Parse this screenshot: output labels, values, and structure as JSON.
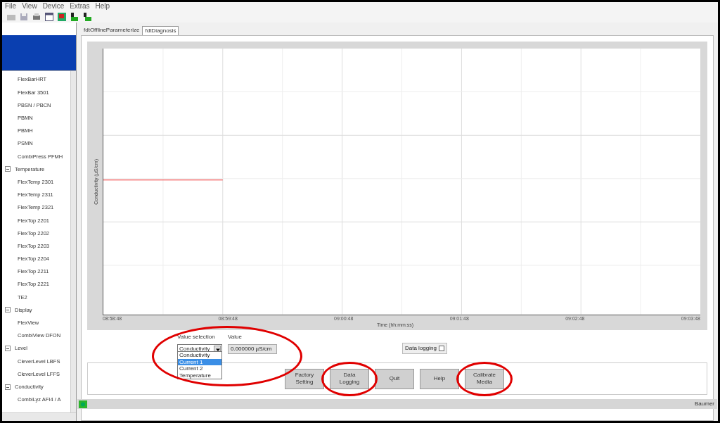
{
  "menu": [
    "File",
    "View",
    "Device",
    "Extras",
    "Help"
  ],
  "toolbar": [
    {
      "kind": "open"
    },
    {
      "kind": "save"
    },
    {
      "kind": "print"
    },
    {
      "kind": "window"
    },
    {
      "kind": "device"
    },
    {
      "kind": "connect"
    },
    {
      "kind": "disconnect"
    }
  ],
  "tree": [
    {
      "children": [
        {
          "label": "FlexBarHRT"
        },
        {
          "label": "FlexBar 3501"
        },
        {
          "label": "PBSN / PBCN"
        },
        {
          "label": "PBMN"
        },
        {
          "label": "PBMH"
        },
        {
          "label": "PSMN"
        },
        {
          "label": "CombiPress PFMH"
        }
      ]
    },
    {
      "label": "Temperature",
      "expanded": true,
      "children": [
        {
          "label": "FlexTemp 2301"
        },
        {
          "label": "FlexTemp 2311"
        },
        {
          "label": "FlexTemp 2321"
        },
        {
          "label": "FlexTop 2201"
        },
        {
          "label": "FlexTop 2202"
        },
        {
          "label": "FlexTop 2203"
        },
        {
          "label": "FlexTop 2204"
        },
        {
          "label": "FlexTop 2211"
        },
        {
          "label": "FlexTop 2221"
        },
        {
          "label": "TE2"
        }
      ]
    },
    {
      "label": "Display",
      "expanded": true,
      "children": [
        {
          "label": "FlexView"
        },
        {
          "label": "CombiView DFON"
        }
      ]
    },
    {
      "label": "Level",
      "expanded": true,
      "children": [
        {
          "label": "CleverLevel LBFS"
        },
        {
          "label": "CleverLevel LFFS"
        }
      ]
    },
    {
      "label": "Conductivity",
      "expanded": true,
      "children": [
        {
          "label": "CombiLyz AFI4 / A"
        }
      ]
    }
  ],
  "tabs": [
    {
      "label": "fdtOfflineParameterize",
      "selected": false
    },
    {
      "label": "fdtDiagnosis",
      "selected": true
    }
  ],
  "chart": {
    "ylabel": "Conductivity (µS/cm)",
    "xlabel": "Time (hh:mm:ss)",
    "xticks": [
      "08:58:48",
      "08:59:48",
      "09:00:48",
      "09:01:48",
      "09:02:48",
      "09:03:48"
    ]
  },
  "value_selection": {
    "label": "Value selection",
    "value": "Conductivity",
    "options": [
      {
        "label": "Conductivity",
        "highlighted": false
      },
      {
        "label": "Current 1",
        "highlighted": true
      },
      {
        "label": "Current 2",
        "highlighted": false
      },
      {
        "label": "Temperature",
        "highlighted": false
      }
    ]
  },
  "value": {
    "label": "Value",
    "value": "0.000000 µS/cm"
  },
  "data_logging": {
    "label": "Data logging",
    "checked": false
  },
  "buttons": [
    {
      "label": "Factory\nSetting",
      "circled": false
    },
    {
      "label": "Data\nLogging",
      "circled": true
    },
    {
      "label": "Quit",
      "circled": false
    },
    {
      "label": "Help",
      "circled": false
    },
    {
      "label": "Calibrate\nMedia",
      "circled": true
    }
  ],
  "status_bar": {
    "text": "Baumer"
  }
}
